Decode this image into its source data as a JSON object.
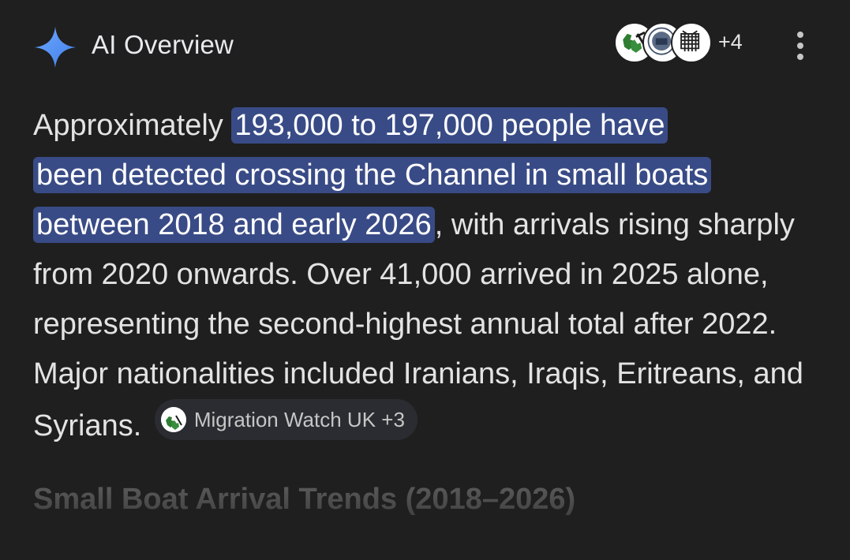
{
  "header": {
    "title": "AI Overview",
    "sparkle_icon": "sparkle-icon",
    "sources": [
      {
        "icon": "migration-watch-logo-icon"
      },
      {
        "icon": "home-office-seal-icon"
      },
      {
        "icon": "parliament-portcullis-icon"
      }
    ],
    "more_sources_count": "+4",
    "menu_icon": "more-vert-icon"
  },
  "overview": {
    "lead": "Approximately ",
    "highlight_line1": "193,000 to 197,000 people have",
    "highlight_line2": "been detected crossing the Channel in small boats",
    "highlight_line3": "between 2018 and early 2026",
    "rest": ", with arrivals rising sharply from 2020 onwards. Over 41,000 arrived in 2025 alone, representing the second-highest annual total after 2022. Major nationalities included Iranians, Iraqis, Eritreans, and Syrians. ",
    "citation": {
      "label": "Migration Watch UK +3",
      "icon": "migration-watch-logo-icon"
    }
  },
  "next_section": {
    "heading": "Small Boat Arrival Trends (2018–2026)"
  },
  "colors": {
    "background": "#1f1f1f",
    "highlight": "#394b86",
    "chip_background": "#2b2c31",
    "text": "#e3e3e3",
    "sparkle": "#4f8df7"
  }
}
